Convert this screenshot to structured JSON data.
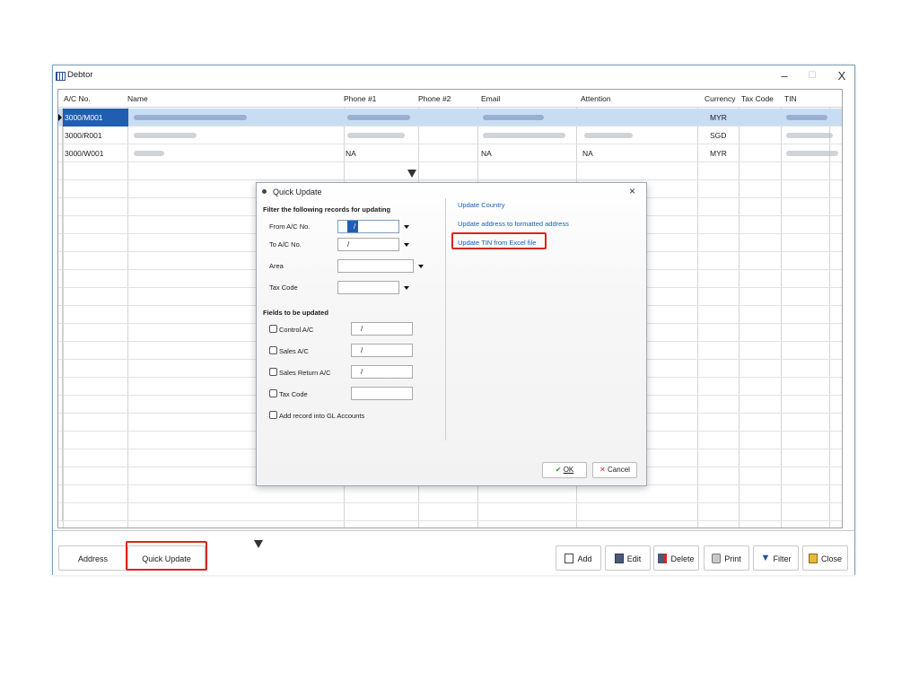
{
  "window": {
    "title": "Debtor",
    "controls": {
      "minimize": "–",
      "maximize": "☐",
      "close": "X"
    }
  },
  "grid": {
    "columns": [
      "A/C No.",
      "Name",
      "Phone #1",
      "Phone #2",
      "Email",
      "Attention",
      "Currency",
      "Tax Code",
      "TIN"
    ],
    "rows": [
      {
        "ac_no": "3000/M001",
        "currency": "MYR",
        "selected": true
      },
      {
        "ac_no": "3000/R001",
        "currency": "SGD",
        "selected": false
      },
      {
        "ac_no": "3000/W001",
        "phone1": "NA",
        "email": "NA",
        "attention": "NA",
        "currency": "MYR",
        "selected": false
      }
    ]
  },
  "dialog": {
    "title": "Quick Update",
    "close": "×",
    "filter_heading": "Filter the following records for updating",
    "filters": {
      "from_ac": {
        "label": "From A/C No.",
        "value": "/"
      },
      "to_ac": {
        "label": "To A/C No.",
        "value": "/"
      },
      "area": {
        "label": "Area",
        "value": ""
      },
      "tax_code": {
        "label": "Tax Code",
        "value": ""
      }
    },
    "fields_heading": "Fields to be updated",
    "fields": {
      "control_ac": {
        "label": "Control A/C",
        "value": "/"
      },
      "sales_ac": {
        "label": "Sales A/C",
        "value": "/"
      },
      "sales_return_ac": {
        "label": "Sales Return A/C",
        "value": "/"
      },
      "tax_code": {
        "label": "Tax Code",
        "value": ""
      },
      "add_gl": {
        "label": "Add record into GL Accounts"
      }
    },
    "links": {
      "update_country": "Update Country",
      "update_address": "Update address to formatted address",
      "update_tin": "Update TIN from Excel file"
    },
    "ok": "OK",
    "cancel": "Cancel"
  },
  "bottom": {
    "address": "Address",
    "quick_update": "Quick Update",
    "add": "Add",
    "edit": "Edit",
    "delete": "Delete",
    "print": "Print",
    "filter": "Filter",
    "close": "Close"
  },
  "colors": {
    "selection": "#1f5eb0",
    "highlight_box": "#d8261f",
    "link": "#1760b0"
  }
}
